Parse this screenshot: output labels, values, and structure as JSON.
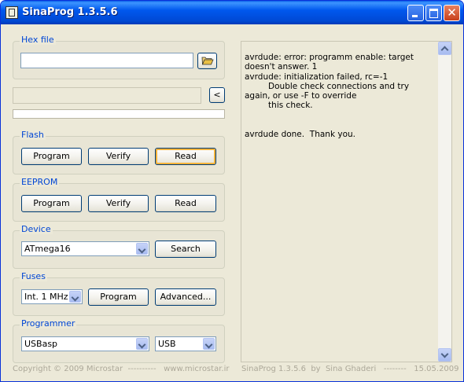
{
  "window": {
    "title": "SinaProg 1.3.5.6",
    "close_glyph": "✕"
  },
  "hex_file": {
    "label": "Hex file",
    "path_value": ""
  },
  "load_button_label": "<",
  "flash": {
    "label": "Flash",
    "program_label": "Program",
    "verify_label": "Verify",
    "read_label": "Read"
  },
  "eeprom": {
    "label": "EEPROM",
    "program_label": "Program",
    "verify_label": "Verify",
    "read_label": "Read"
  },
  "device": {
    "label": "Device",
    "selected": "ATmega16",
    "search_label": "Search"
  },
  "fuses": {
    "label": "Fuses",
    "selected": "Int. 1 MHz",
    "program_label": "Program",
    "advanced_label": "Advanced..."
  },
  "programmer": {
    "label": "Programmer",
    "selected": "USBasp",
    "port_selected": "USB"
  },
  "log": {
    "text": "avrdude: error: programm enable: target doesn't answer. 1\navrdude: initialization failed, rc=-1\n         Double check connections and try again, or use -F to override\n         this check.\n\n\navrdude done.  Thank you."
  },
  "footer": {
    "left": "Copyright © 2009 Microstar  ----------   www.microstar.ir",
    "right": "SinaProg 1.3.5.6  by  Sina Ghaderi   --------   15.05.2009"
  },
  "colors": {
    "title_bar": "#0054e3",
    "group_label": "#0046d5",
    "focus_ring": "#f8b33a"
  },
  "icons": [
    "app-icon",
    "folder-open-icon",
    "minimize-icon",
    "maximize-icon",
    "close-icon"
  ]
}
